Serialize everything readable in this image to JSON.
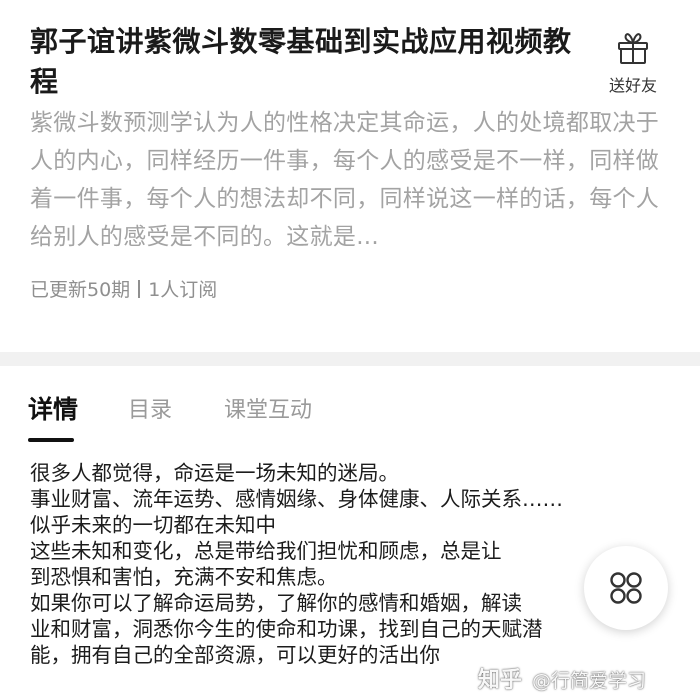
{
  "course": {
    "title": "郭子谊讲紫微斗数零基础到实战应用视频教程",
    "share_label": "送好友",
    "description": "紫微斗数预测学认为人的性格决定其命运，人的处境都取决于人的内心，同样经历一件事，每个人的感受是不一样，同样做着一件事，每个人的想法却不同，同样说这一样的话，每个人给别人的感受是不同的。这就是...",
    "updated": "已更新50期",
    "subscribers": "1人订阅"
  },
  "tabs": [
    {
      "label": "详情",
      "active": true
    },
    {
      "label": "目录",
      "active": false
    },
    {
      "label": "课堂互动",
      "active": false
    }
  ],
  "detail": {
    "lines": [
      "很多人都觉得，命运是一场未知的迷局。",
      "事业财富、流年运势、感情姻缘、身体健康、人际关系……",
      "似乎未来的一切都在未知中",
      "这些未知和变化，总是带给我们担忧和顾虑，总是让",
      "到恐惧和害怕，充满不安和焦虑。",
      "如果你可以了解命运局势，了解你的感情和婚姻，解读",
      "业和财富，洞悉你今生的使命和功课，找到自己的天赋潜",
      "能，拥有自己的全部资源，可以更好的活出你"
    ]
  },
  "watermark": {
    "brand": "知乎",
    "handle": "@行简爱学习"
  },
  "icons": {
    "share": "gift-icon",
    "fab": "grid-icon"
  },
  "colors": {
    "title": "#1a1a1a",
    "description": "#a3a3a3",
    "meta": "#8f8f8f",
    "tab_inactive": "#9a9a9a",
    "tab_active": "#111111"
  }
}
